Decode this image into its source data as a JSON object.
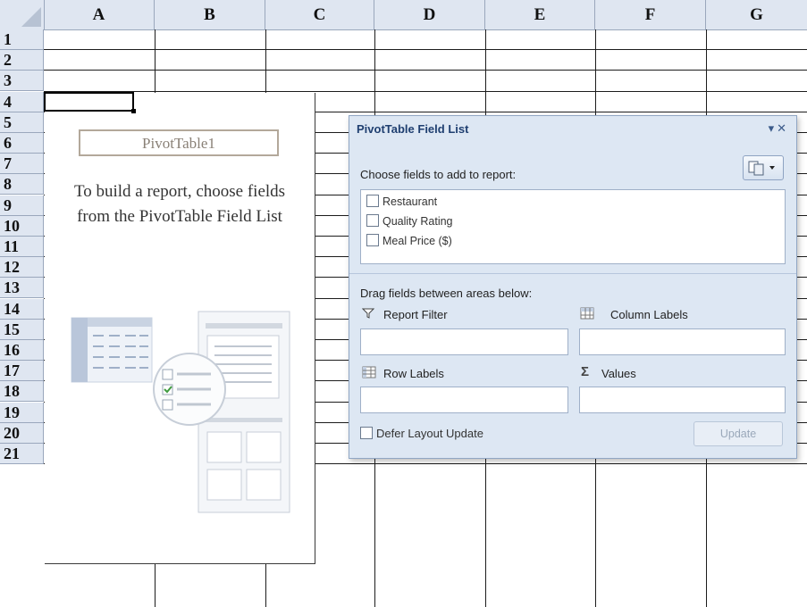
{
  "columns": [
    "A",
    "B",
    "C",
    "D",
    "E",
    "F",
    "G"
  ],
  "rows": [
    "1",
    "2",
    "3",
    "4",
    "5",
    "6",
    "7",
    "8",
    "9",
    "10",
    "11",
    "12",
    "13",
    "14",
    "15",
    "16",
    "17",
    "18",
    "19",
    "20",
    "21"
  ],
  "placeholder": {
    "name": "PivotTable1",
    "message_line1": "To build a report, choose fields",
    "message_line2": "from the PivotTable Field List"
  },
  "field_list": {
    "title": "PivotTable Field List",
    "choose_label": "Choose fields to add to report:",
    "fields": [
      {
        "label": "Restaurant",
        "checked": false
      },
      {
        "label": "Quality Rating",
        "checked": false
      },
      {
        "label": "Meal Price ($)",
        "checked": false
      }
    ],
    "drag_label": "Drag fields between areas below:",
    "areas": {
      "report_filter": "Report Filter",
      "column_labels": "Column Labels",
      "row_labels": "Row Labels",
      "values": "Values"
    },
    "defer_label": "Defer Layout Update",
    "update_label": "Update"
  },
  "icons": {
    "filter": "funnel-icon",
    "columns": "grid-icon",
    "rows": "rows-grid-icon",
    "values": "sigma-icon"
  }
}
